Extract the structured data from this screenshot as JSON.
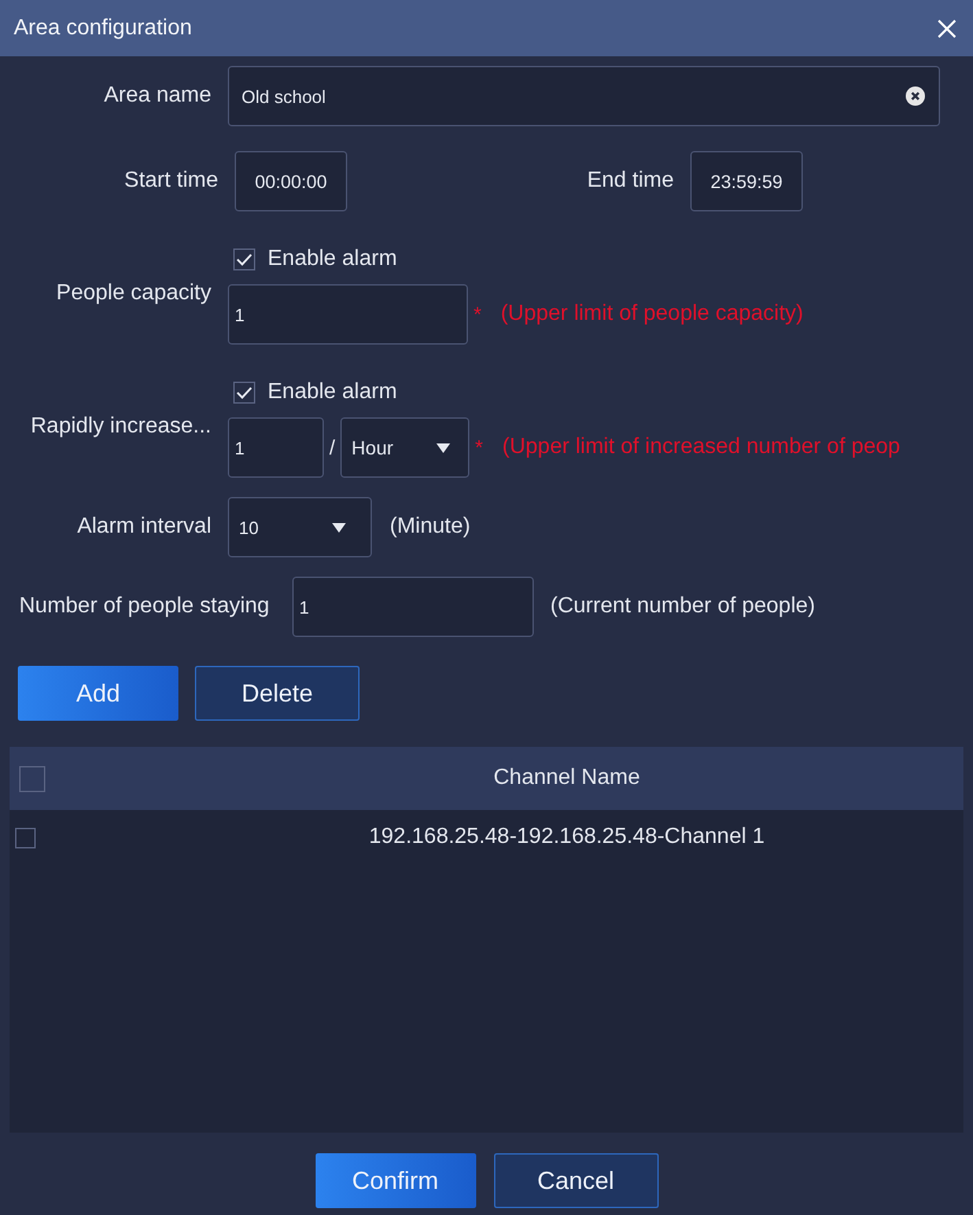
{
  "window": {
    "title": "Area configuration"
  },
  "form": {
    "area_name": {
      "label": "Area name",
      "value": "Old school"
    },
    "start_time": {
      "label": "Start time",
      "value": "00:00:00"
    },
    "end_time": {
      "label": "End time",
      "value": "23:59:59"
    },
    "people_capacity": {
      "alarm": {
        "label": "Enable alarm",
        "checked": true
      },
      "label": "People capacity",
      "value": "1",
      "required_mark": "*",
      "hint": "(Upper limit of people capacity)"
    },
    "rapid_increase": {
      "alarm": {
        "label": "Enable alarm",
        "checked": true
      },
      "label": "Rapidly increase...",
      "value": "1",
      "separator": "/",
      "period": "Hour",
      "required_mark": "*",
      "hint": "(Upper limit of increased number of peop"
    },
    "alarm_interval": {
      "label": "Alarm interval",
      "value": "10",
      "unit": "(Minute)"
    },
    "people_staying": {
      "label": "Number of people staying",
      "value": "1",
      "hint": "(Current number of people)"
    }
  },
  "actions": [
    {
      "label": "Add",
      "kind": "primary"
    },
    {
      "label": "Delete",
      "kind": "secondary"
    }
  ],
  "table": {
    "select_all": {
      "checked": false
    },
    "columns": [
      "Channel Name"
    ],
    "rows": [
      {
        "checked": false,
        "cells": [
          "192.168.25.48-192.168.25.48-Channel 1"
        ]
      }
    ]
  },
  "footer": {
    "buttons": [
      {
        "label": "Confirm",
        "kind": "primary"
      },
      {
        "label": "Cancel",
        "kind": "secondary"
      }
    ]
  }
}
